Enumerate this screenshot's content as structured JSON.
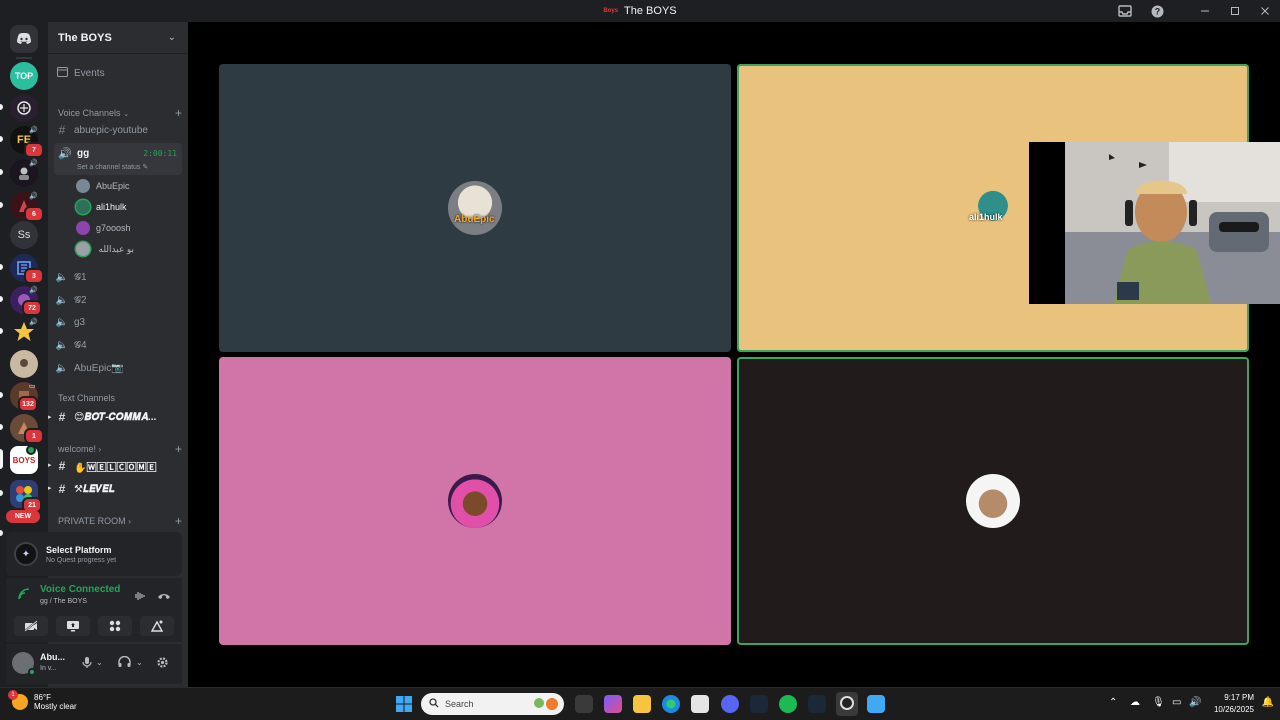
{
  "window": {
    "server_tag": "Boys",
    "title": "The BOYS"
  },
  "server": {
    "name": "The BOYS"
  },
  "rail": {
    "top_icon": "TOP",
    "fe_icon": "FE",
    "ss_icon": "Ss",
    "boys_icon": "BOYS",
    "new_badge": "NEW",
    "badges": {
      "fe": "7",
      "r1": "6",
      "r2": "3",
      "r3": "72",
      "r4": "132",
      "r5": "1",
      "r6": "21"
    }
  },
  "sidebar": {
    "events": "Events",
    "voice_category": "Voice Channels",
    "text_category": "Text Channels",
    "welcome_category": "welcome!",
    "private_category": "PRIVATE ROOM",
    "channels": {
      "abuepic_youtube": "abuepic-youtube",
      "gg": "gg",
      "gg_timer": "2:00:11",
      "gg_status": "Set a channel status",
      "g1": "𝓖1",
      "g2": "𝓖2",
      "g3": "g3",
      "g4": "𝓖4",
      "abuepic": "AbuEpic📷",
      "bot_commands": "😊𝑩𝑶𝑻-𝑪𝑶𝑴𝑴𝑨...",
      "welcome": "✋🅆🄴🄻🄲🄾🄼🄴",
      "level": "⚒𝑳𝑬𝑽𝑬𝑳"
    },
    "members": [
      "AbuEpic",
      "ali1hulk",
      "g7ooosh",
      "بو عبدالله ‏"
    ]
  },
  "quest": {
    "title": "Select Platform",
    "subtitle": "No Quest progress yet"
  },
  "voice": {
    "status": "Voice Connected",
    "location": "gg / The BOYS"
  },
  "user": {
    "name": "Abu...",
    "status": "In v..."
  },
  "stage": {
    "tiles": [
      {
        "color": "#2f3b43",
        "speaking": false
      },
      {
        "color": "#e9c37d",
        "speaking": true
      },
      {
        "color": "#d174a8",
        "speaking": false
      },
      {
        "color": "#211c1b",
        "speaking": true
      }
    ],
    "avatar_labels": {
      "t1": "AbuEpic",
      "t2": "ali1hulk"
    }
  },
  "taskbar": {
    "temp": "86°F",
    "weather": "Mostly clear",
    "search_placeholder": "Search",
    "time": "9:17 PM",
    "date": "10/26/2025"
  }
}
